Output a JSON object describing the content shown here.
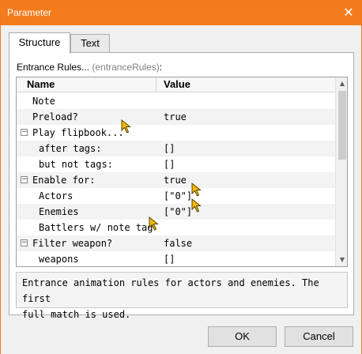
{
  "window": {
    "title": "Parameter",
    "close_glyph": "✕"
  },
  "tabs": [
    {
      "label": "Structure",
      "active": true
    },
    {
      "label": "Text",
      "active": false
    }
  ],
  "field": {
    "label": "Entrance Rules...",
    "key": "(entranceRules)",
    "colon": ":"
  },
  "grid": {
    "headers": {
      "name": "Name",
      "value": "Value"
    },
    "rows": [
      {
        "name": "Note",
        "value": "",
        "expander": ""
      },
      {
        "name": "Preload?",
        "value": "true",
        "expander": ""
      },
      {
        "name": "Play flipbook...",
        "value": "",
        "expander": "⊟"
      },
      {
        "name": "after tags:",
        "value": "[]",
        "expander": ""
      },
      {
        "name": "but not tags:",
        "value": "[]",
        "expander": ""
      },
      {
        "name": "Enable for:",
        "value": "true",
        "expander": "⊟"
      },
      {
        "name": "Actors",
        "value": "[\"0\"]",
        "expander": ""
      },
      {
        "name": "Enemies",
        "value": "[\"0\"]",
        "expander": ""
      },
      {
        "name": "Battlers w/ note tag",
        "value": "",
        "expander": ""
      },
      {
        "name": "Filter weapon?",
        "value": "false",
        "expander": "⊟"
      },
      {
        "name": "weapons",
        "value": "[]",
        "expander": ""
      }
    ]
  },
  "description": "Entrance animation rules for actors and enemies. The first\nfull match is used.",
  "buttons": {
    "ok": "OK",
    "cancel": "Cancel"
  },
  "colors": {
    "titlebar": "#f47c1c",
    "cursor": "#f5b800"
  },
  "icons": {
    "close": "close-icon",
    "expander": "collapse-icon",
    "cursor": "mouse-pointer-icon"
  }
}
